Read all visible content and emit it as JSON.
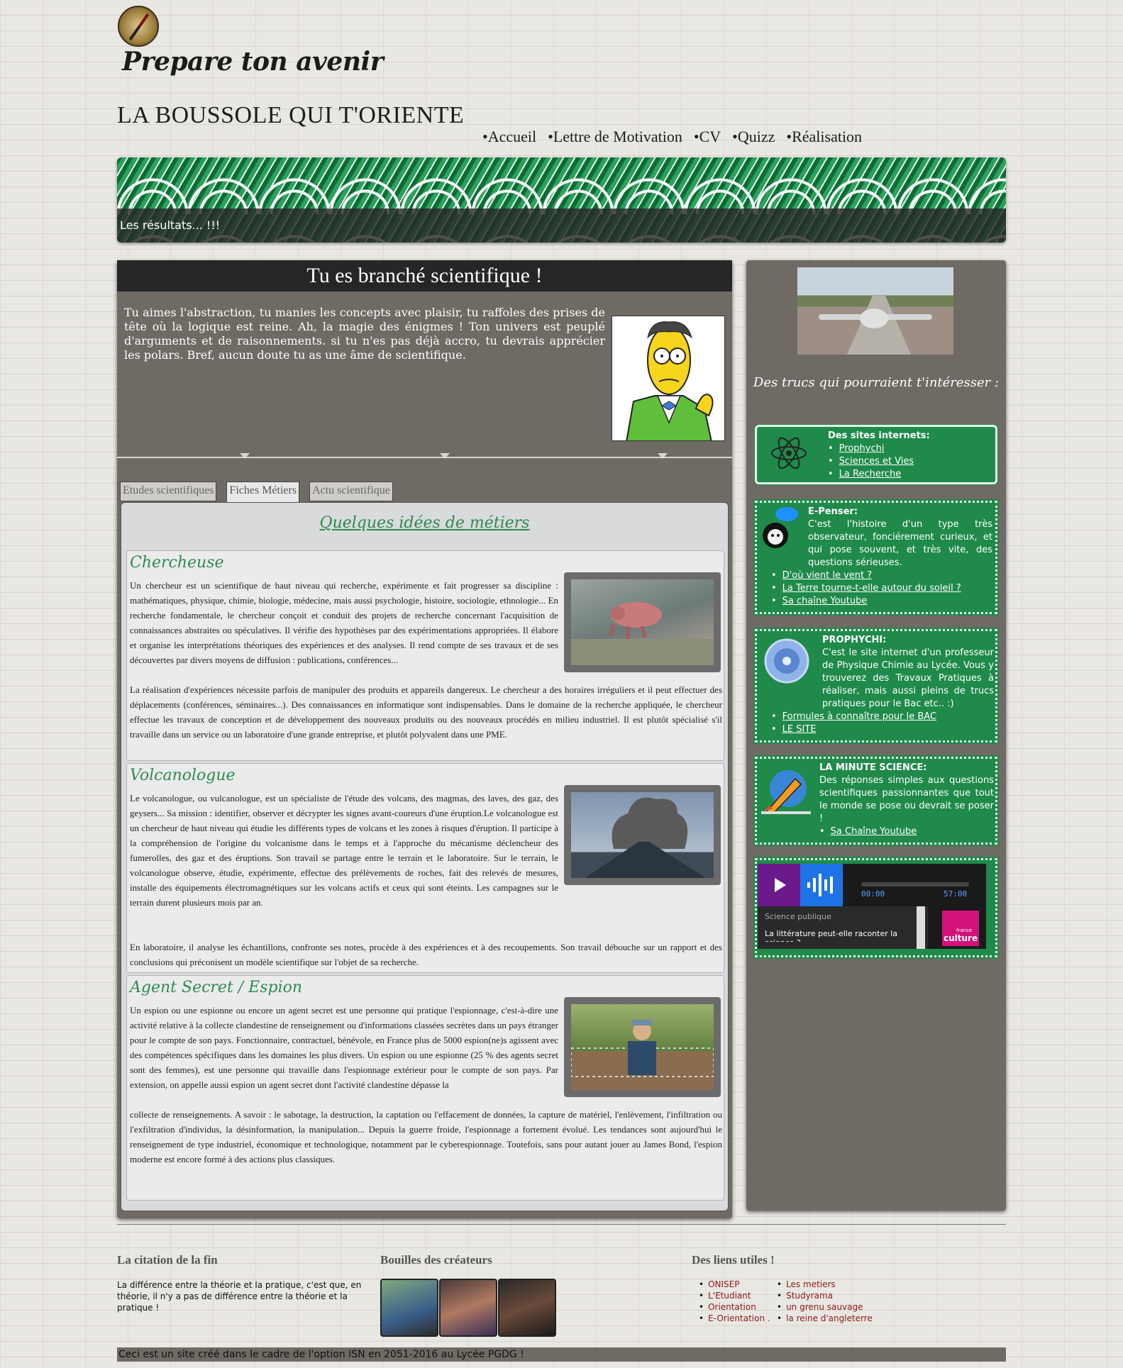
{
  "header": {
    "tagline": "Prepare ton avenir",
    "site_title": "LA BOUSSOLE QUI T'ORIENTE",
    "nav": [
      "Accueil",
      "Lettre de Motivation",
      "CV",
      "Quizz",
      "Réalisation"
    ]
  },
  "banner": {
    "text": "Les résultats... !!!"
  },
  "main": {
    "title": "Tu es branché scientifique !",
    "intro": "Tu aimes l'abstraction, tu manies les concepts avec plaisir, tu raffoles des prises de tête où la logique est reine. Ah, la magie des énigmes ! Ton univers est peuplé d'arguments et de raisonnements. si tu n'es pas déjà accro, tu devrais apprécier les polars. Bref, aucun doute tu as une âme de scientifique.",
    "tabs": [
      "Etudes scientifiques",
      "Fiches Métiers",
      "Actu scientifique"
    ],
    "active_tab": "Fiches Métiers",
    "content_title": "Quelques idées de métiers",
    "jobs": [
      {
        "title": "Chercheuse",
        "text_top": "Un chercheur est un scientifique de haut niveau qui recherche, expérimente et fait progresser sa discipline : mathématiques, physique, chimie, biologie, médecine, mais aussi psychologie, histoire, sociologie, ethnologie... En recherche fondamentale, le chercheur conçoit et conduit des projets de recherche concernant l'acquisition de connaissances abstraites ou spéculatives. Il vérifie des hypothèses par des expérimentations appropriées. Il élabore et organise les interprétations théoriques des expériences et des analyses. Il rend compte de ses travaux et de ses découvertes par divers moyens de diffusion : publications, conférences...",
        "text_bottom": "La réalisation d'expériences nécessite parfois de manipuler des produits et appareils dangereux. Le chercheur a des horaires irréguliers et il peut effectuer des déplacements (conférences, séminaires...). Des connaissances en informatique sont indispensables. Dans le domaine de la recherche appliquée, le chercheur effectue les travaux de conception et de développement des nouveaux produits ou des nouveaux procédés en milieu industriel. Il est plutôt spécialisé s'il travaille dans un service ou un laboratoire d'une grande entreprise, et plutôt polyvalent dans une PME."
      },
      {
        "title": "Volcanologue",
        "text_top": "Le volcanologue, ou vulcanologue, est un spécialiste de l'étude des volcans, des magmas, des laves, des gaz, des geysers... Sa mission : identifier, observer et décrypter les signes avant-coureurs d'une éruption.Le volcanologue est un chercheur de haut niveau qui étudie les différents types de volcans et les zones à risques d'éruption. Il participe à la compréhension de l'origine du volcanisme dans le temps et à l'approche du mécanisme déclencheur des fumerolles, des gaz et des éruptions. Son travail se partage entre le terrain et le laboratoire. Sur le terrain, le volcanologue observe, étudie, expérimente, effectue des prélèvements de roches, fait des relevés de mesures, installe des équipements électromagnétiques sur les volcans actifs et ceux qui sont éteints. Les campagnes sur le terrain durent plusieurs mois par an.",
        "text_bottom": "En laboratoire, il analyse les échantillons, confronte ses notes, procède à des expériences et à des recoupements. Son travail débouche sur un rapport et des conclusions qui préconisent un modèle scientifique sur l'objet de sa recherche."
      },
      {
        "title": "Agent Secret / Espion",
        "text_top": "Un espion ou une espionne ou encore un agent secret est une personne qui pratique l'espionnage, c'est-à-dire une activité relative à la collecte clandestine de renseignement ou d'informations classées secrètes dans un pays étranger pour le compte de son pays. Fonctionnaire, contractuel, bénévole, en France plus de 5000 espion(ne)s agissent avec des compétences spécifiques dans les domaines les plus divers. Un espion ou une espionne (25 % des agents secret sont des femmes), est une personne qui travaille dans l'espionnage extérieur pour le compte de son pays. Par extension, on appelle aussi espion un agent secret dont l'activité clandestine dépasse la",
        "text_bottom": "collecte de renseignements. A savoir : le sabotage, la destruction, la captation ou l'effacement de données, la capture de matériel, l'enlèvement, l'infiltration ou l'exfiltration d'individus, la désinformation, la manipulation... Depuis la guerre froide, l'espionnage a fortement évolué. Les tendances sont aujourd'hui le renseignement de type industriel, économique et technologique, notamment par le cyberespionnage. Toutefois, sans pour autant jouer au James Bond, l'espion moderne est encore formé à des actions plus classiques."
      }
    ]
  },
  "sidebar": {
    "heading": "Des trucs qui pourraient t'intéresser :",
    "box1": {
      "title": "Des sites internets:",
      "links": [
        "Prophychi",
        "Sciences et Vies",
        "La Recherche"
      ]
    },
    "box2": {
      "title": "E-Penser:",
      "text": "C'est l'histoire d'un type très observateur, fonciérement curieux, et qui pose souvent, et très vite, des questions sérieuses.",
      "links": [
        "D'où vient le vent ?",
        "La Terre tourne-t-elle autour du soleil ?",
        "Sa chaîne Youtube"
      ]
    },
    "box3": {
      "title": "PROPHYCHI:",
      "text": "C'est le site internet d'un professeur de Physique Chimie au Lycée. Vous y trouverez des Travaux Pratiques à réaliser, mais aussi pleins de trucs pratiques pour le Bac etc.. :)",
      "links": [
        "Formules à connaître pour le BAC",
        "LE SITE"
      ]
    },
    "box4": {
      "title": "LA MINUTE SCIENCE:",
      "text": "Des réponses simples aux questions scientifiques passionnantes que tout le monde se pose ou devrait se poser !",
      "links": [
        "Sa Chaîne Youtube"
      ]
    },
    "player": {
      "time_start": "00:00",
      "time_end": "57:00",
      "show": "Science publique",
      "episode": "La littérature peut-elle raconter la science ?",
      "brand_small": "france",
      "brand": "culture"
    }
  },
  "footer": {
    "quote_title": "La citation de la fin",
    "quote": "La différence entre la théorie et la pratique, c'est que, en théorie, il n'y a pas de différence entre la théorie et la pratique !",
    "creators_title": "Bouilles des créateurs",
    "links_title": "Des liens utiles !",
    "links_col1": [
      "ONISEP",
      "L'Etudiant",
      "Orientation",
      "E-Orientation ."
    ],
    "links_col2": [
      "Les metiers",
      "Studyrama",
      "un grenu sauvage",
      "la reine d'angleterre"
    ],
    "bottom": "Ceci est un site créé dans le cadre de l'option ISN en 2051-2016 au Lycée PGDG !"
  }
}
